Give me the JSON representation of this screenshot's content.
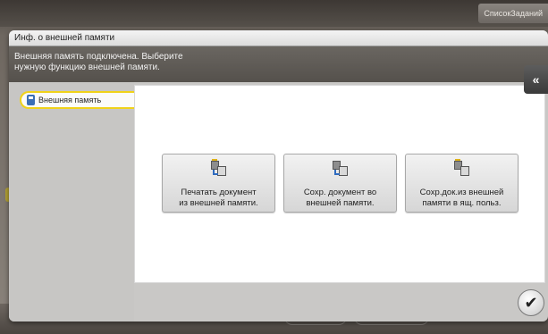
{
  "topbar": {
    "job_list_label": "СписокЗаданий"
  },
  "dialog": {
    "title": "Инф. о внешней памяти",
    "message_line1": "Внешняя память подключена. Выберите",
    "message_line2": "нужную функцию внешней памяти."
  },
  "sidebar": {
    "items": [
      {
        "label": "Внешняя память",
        "icon": "usb-memory-icon",
        "selected": true
      }
    ]
  },
  "functions": [
    {
      "label": "Печатать документ\nиз внешней памяти.",
      "icon": "print-from-memory-icon"
    },
    {
      "label": "Сохр. документ во\nвнешней памяти.",
      "icon": "save-to-memory-icon"
    },
    {
      "label": "Сохр.док.из внешней\nпамяти в ящ. польз.",
      "icon": "save-to-user-box-icon"
    }
  ],
  "controls": {
    "collapse_icon": "double-chevron-left-icon",
    "ok_icon": "checkmark-icon"
  },
  "colors": {
    "accent_yellow": "#f0d21a",
    "usb_blue": "#3b6fb6"
  }
}
